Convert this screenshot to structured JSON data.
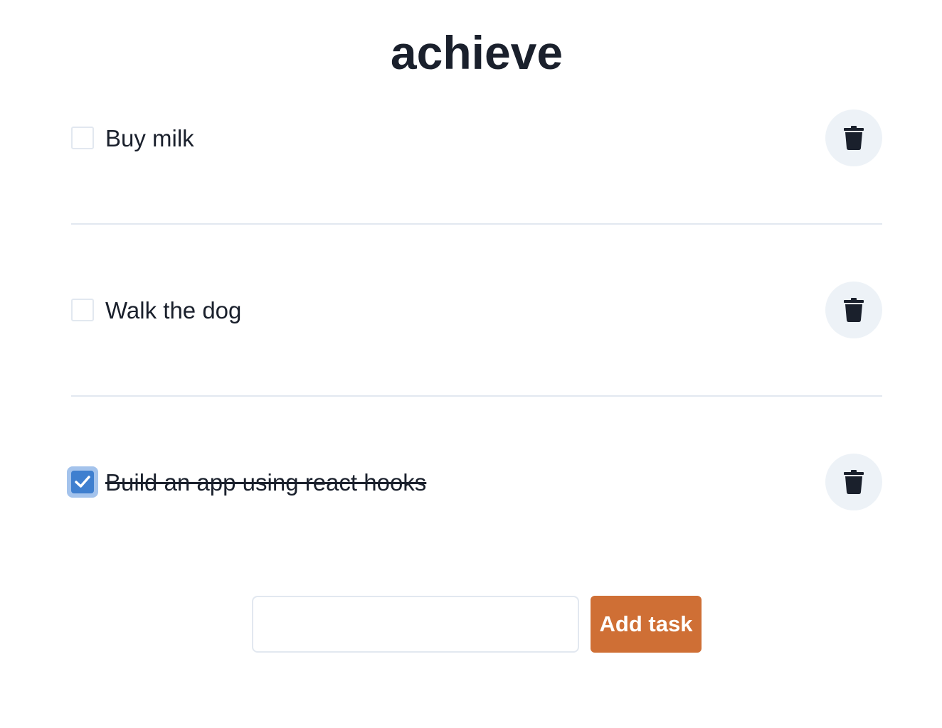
{
  "app": {
    "title": "achieve"
  },
  "tasks": [
    {
      "label": "Buy milk",
      "completed": false,
      "delete_icon": "trash-icon"
    },
    {
      "label": "Walk the dog",
      "completed": false,
      "delete_icon": "trash-icon"
    },
    {
      "label": "Build an app using react hooks",
      "completed": true,
      "delete_icon": "trash-icon"
    }
  ],
  "new_task": {
    "value": "",
    "placeholder": "",
    "button_label": "Add task"
  },
  "colors": {
    "text": "#1a202c",
    "divider": "#e2e8f0",
    "delete_button_bg": "#edf2f7",
    "checkbox_checked": "#3f7fcf",
    "checkbox_focus_ring": "#a4c3ec",
    "add_button_bg": "#cf6f35"
  }
}
